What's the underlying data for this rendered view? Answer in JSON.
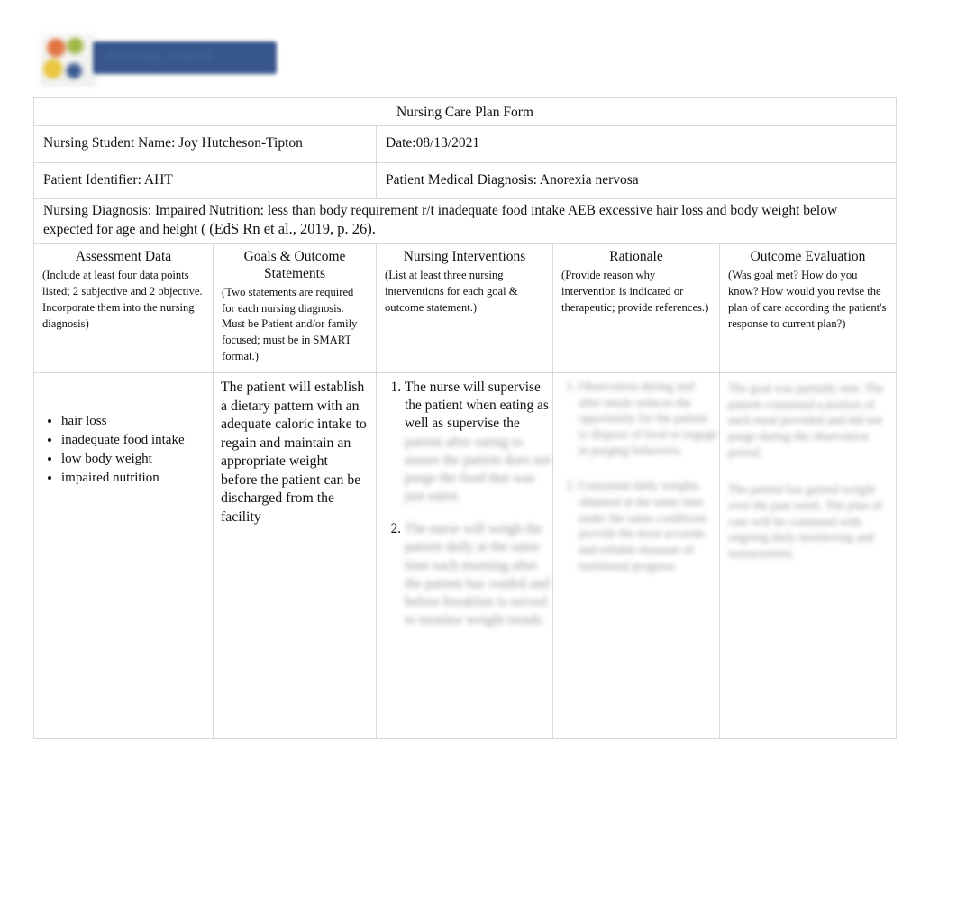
{
  "logo": {
    "alt_text": "Nursing School",
    "note": "blurred institutional logo"
  },
  "form": {
    "title": "Nursing Care Plan Form"
  },
  "meta": {
    "student_name_label": "Nursing Student Name: Joy Hutcheson-Tipton",
    "date_label": "Date:08/13/2021",
    "patient_identifier_label": "Patient Identifier: AHT",
    "medical_diagnosis_label": "Patient Medical Diagnosis: Anorexia nervosa"
  },
  "diagnosis": {
    "text": "Nursing Diagnosis: Impaired Nutrition: less than body requirement r/t inadequate food intake AEB excessive hair loss and body weight below expected for age and height ( ",
    "citation": "(EdS Rn et al., 2019, p. 26)."
  },
  "columns": [
    {
      "header": "Assessment Data",
      "instructions": "(Include at least four data points listed; 2 subjective and 2 objective. Incorporate them into the nursing diagnosis)"
    },
    {
      "header": "Goals & Outcome Statements",
      "instructions": "(Two statements are required for each nursing diagnosis. Must be Patient and/or family focused; must be in SMART format.)"
    },
    {
      "header": "Nursing Interventions",
      "instructions": "(List at least three nursing interventions for each goal & outcome statement.)"
    },
    {
      "header": "Rationale",
      "instructions": "(Provide reason why intervention is indicated or therapeutic; provide references.)"
    },
    {
      "header": "Outcome Evaluation",
      "instructions": "(Was goal met?  How do you know? How would you revise the plan of care according the patient's response to current plan?)"
    }
  ],
  "assessment_data": {
    "items": [
      "hair loss",
      "inadequate food intake",
      "low body weight",
      "impaired nutrition"
    ]
  },
  "goals": {
    "statement_1": "The patient will establish a dietary pattern with an adequate caloric intake to regain and maintain an appropriate weight before the patient can be discharged from the facility"
  },
  "interventions": {
    "item_1_visible": "The nurse will supervise the patient when eating as well as supervise the",
    "item_1_redacted": "patient after eating to assure the patient does not purge the food that was just eaten.",
    "item_2_redacted": "The nurse will weigh the patient daily at the same time each morning after the patient has voided and before breakfast is served to monitor weight trends."
  },
  "rationale": {
    "item_1_redacted": "Observation during and after meals reduces the opportunity for the patient to dispose of food or engage in purging behaviors.",
    "item_2_redacted": "Consistent daily weights obtained at the same time under the same conditions provide the most accurate and reliable measure of nutritional progress."
  },
  "outcome_evaluation": {
    "item_1_redacted": "The goal was partially met. The patient consumed a portion of each meal provided and did not purge during the observation period.",
    "item_2_redacted": "The patient has gained weight over the past week. The plan of care will be continued with ongoing daily monitoring and reassessment."
  }
}
